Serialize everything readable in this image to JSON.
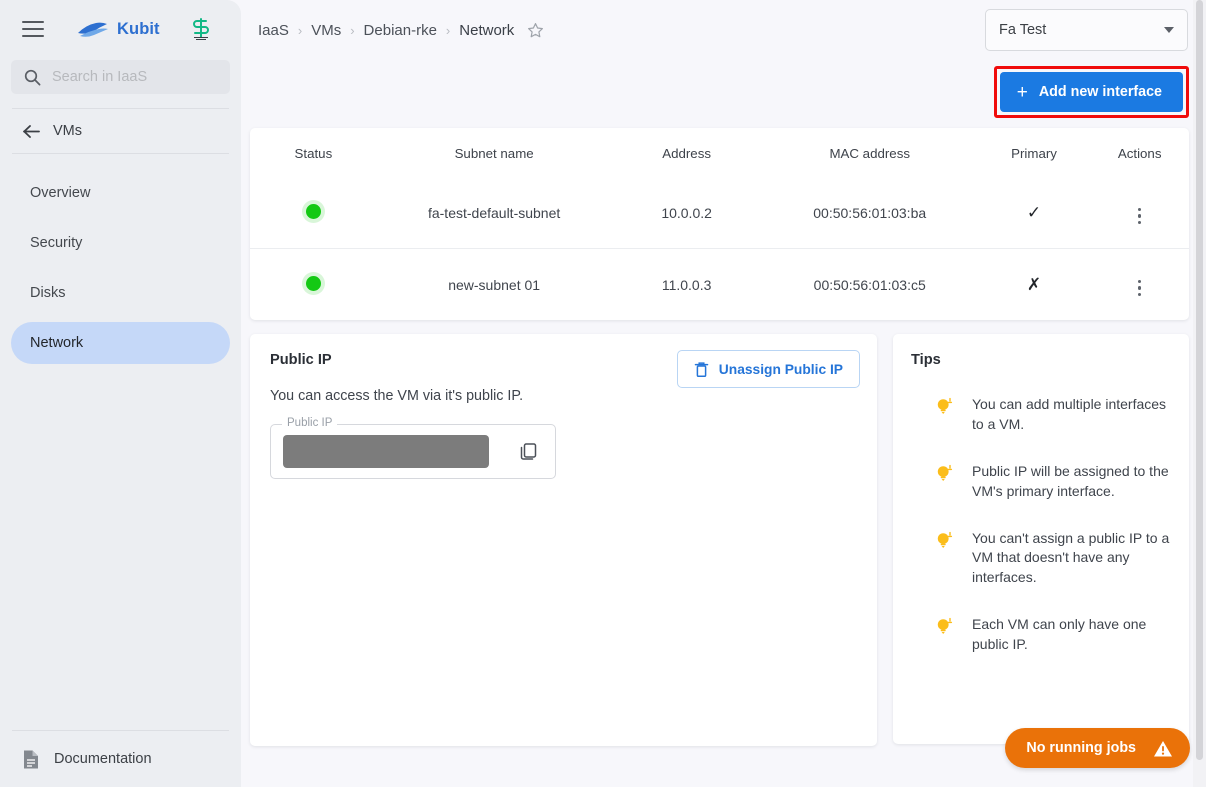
{
  "sidebar": {
    "menu_icon": "hamburger-icon",
    "brand": "Kubit",
    "partner_logo": "s-logo-icon",
    "search": {
      "placeholder": "Search in IaaS",
      "value": "",
      "icon": "search-icon"
    },
    "back": {
      "label": "VMs",
      "icon": "arrow-left-icon"
    },
    "items": [
      {
        "label": "Overview",
        "active": false
      },
      {
        "label": "Security",
        "active": false
      },
      {
        "label": "Disks",
        "active": false
      },
      {
        "label": "Network",
        "active": true
      }
    ],
    "footer": {
      "label": "Documentation",
      "icon": "document-icon"
    }
  },
  "topbar": {
    "breadcrumbs": [
      "IaaS",
      "VMs",
      "Debian-rke",
      "Network"
    ],
    "separator": "›",
    "favorite_icon": "star-outline-icon",
    "project_select": {
      "value": "Fa Test",
      "icon": "chevron-down-icon"
    },
    "add_button": {
      "label": "Add new interface",
      "plus": "+",
      "highlight_color": "#f00b0b",
      "color": "#1b7ae2"
    }
  },
  "table": {
    "headers": [
      "Status",
      "Subnet name",
      "Address",
      "MAC address",
      "Primary",
      "Actions"
    ],
    "rows": [
      {
        "status": "online",
        "status_color": "#14c914",
        "subnet": "fa-test-default-subnet",
        "address": "10.0.0.2",
        "mac": "00:50:56:01:03:ba",
        "primary": "✓",
        "actions_icon": "kebab-menu-icon"
      },
      {
        "status": "online",
        "status_color": "#14c914",
        "subnet": "new-subnet 01",
        "address": "11.0.0.3",
        "mac": "00:50:56:01:03:c5",
        "primary": "✗",
        "actions_icon": "kebab-menu-icon"
      }
    ]
  },
  "public_ip": {
    "title": "Public IP",
    "description": "You can access the VM via it's public IP.",
    "unassign_button": {
      "label": "Unassign Public IP",
      "icon": "trash-icon"
    },
    "field": {
      "label": "Public IP",
      "value": "",
      "redacted": true,
      "copy_icon": "copy-icon"
    }
  },
  "tips": {
    "title": "Tips",
    "icon": "lightbulb-icon",
    "items": [
      "You can add multiple interfaces to a VM.",
      "Public IP will be assigned to the VM's primary interface.",
      "You can't assign a public IP to a VM that doesn't have any interfaces.",
      "Each VM can only have one public IP."
    ]
  },
  "status_pill": {
    "label": "No running jobs",
    "icon": "warning-triangle-icon",
    "color": "#ea7209"
  }
}
